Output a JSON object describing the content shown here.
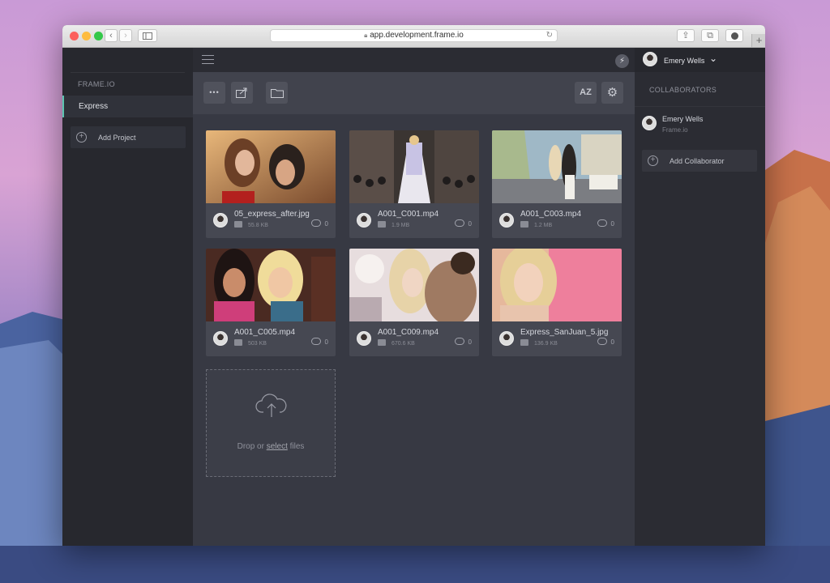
{
  "browser": {
    "url": "app.development.frame.io",
    "new_tab": "+"
  },
  "sidebar": {
    "brand": "FRAME.IO",
    "project": "Express",
    "add_project": "Add Project"
  },
  "header": {
    "user_name": "Emery Wells"
  },
  "toolbar": {
    "more": "•••",
    "sort": "AZ"
  },
  "files": [
    {
      "name": "05_express_after.jpg",
      "size": "55.8 KB",
      "comments": "0",
      "type": "image"
    },
    {
      "name": "A001_C001.mp4",
      "size": "1.9 MB",
      "comments": "0",
      "type": "video"
    },
    {
      "name": "A001_C003.mp4",
      "size": "1.2 MB",
      "comments": "0",
      "type": "video"
    },
    {
      "name": "A001_C005.mp4",
      "size": "503 KB",
      "comments": "0",
      "type": "video"
    },
    {
      "name": "A001_C009.mp4",
      "size": "670.6 KB",
      "comments": "0",
      "type": "video"
    },
    {
      "name": "Express_SanJuan_5.jpg",
      "size": "136.9 KB",
      "comments": "0",
      "type": "image"
    }
  ],
  "upload": {
    "prefix": "Drop or ",
    "link": "select",
    "suffix": " files"
  },
  "collaborators": {
    "title": "COLLABORATORS",
    "items": [
      {
        "name": "Emery Wells",
        "org": "Frame.io"
      }
    ],
    "add_label": "Add Collaborator"
  },
  "colors": {
    "accent": "#5cc4b0",
    "panel": "#2e3038",
    "content": "#373943"
  }
}
